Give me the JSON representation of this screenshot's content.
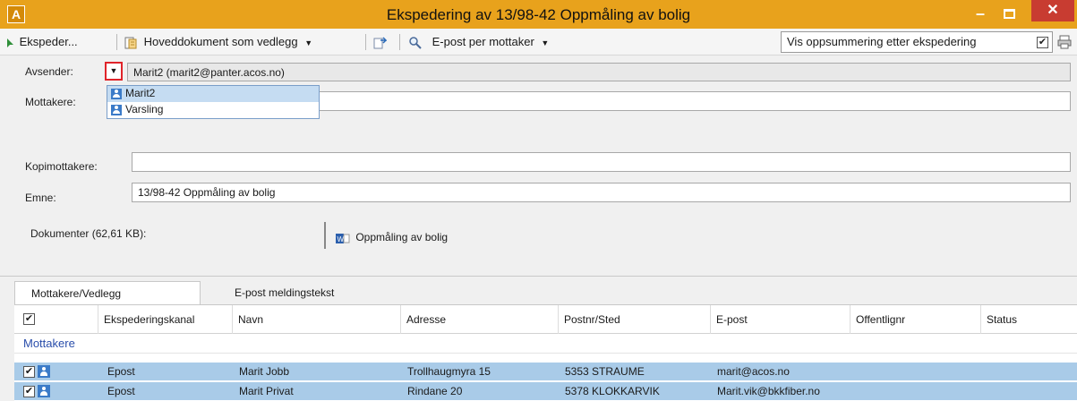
{
  "window": {
    "app_icon_glyph": "A",
    "title": "Ekspedering av 13/98-42 Oppmåling av bolig",
    "minimize_glyph": "–",
    "close_glyph": "✕"
  },
  "toolbar": {
    "ekspeder_label": "Ekspeder...",
    "hoveddokument_label": "Hoveddokument som vedlegg",
    "epost_per_mottaker_label": "E-post per mottaker",
    "vis_oppsummering_label": "Vis oppsummering etter ekspedering",
    "vis_oppsummering_checked": true,
    "icons": [
      "send-icon",
      "document-attach-icon",
      "forward-icon",
      "search-icon",
      "print-icon"
    ]
  },
  "form": {
    "avsender_label": "Avsender:",
    "avsender_value": "Marit2 (marit2@panter.acos.no)",
    "avsender_options": [
      "Marit2",
      "Varsling"
    ],
    "avsender_selected": "Marit2",
    "mottakere_label": "Mottakere:",
    "mottakere_value": "",
    "kopimottakere_label": "Kopimottakere:",
    "kopimottakere_value": "",
    "emne_label": "Emne:",
    "emne_value": "13/98-42 Oppmåling av bolig",
    "dokumenter_label": "Dokumenter (62,61 KB):",
    "document_name": "Oppmåling av bolig"
  },
  "tabs": [
    {
      "label": "Mottakere/Vedlegg",
      "active": true
    },
    {
      "label": "E-post meldingstekst",
      "active": false
    }
  ],
  "grid": {
    "columns": [
      "Ekspederingskanal",
      "Navn",
      "Adresse",
      "Postnr/Sted",
      "E-post",
      "Offentlignr",
      "Status"
    ],
    "header_checked": true,
    "group_label": "Mottakere",
    "rows": [
      {
        "kanal": "Epost",
        "navn": "Marit Jobb",
        "adresse": "Trollhaugmyra 15",
        "postnr_sted": "5353 STRAUME",
        "epost": "marit@acos.no",
        "offentlignr": "",
        "status": "",
        "checked": true
      },
      {
        "kanal": "Epost",
        "navn": "Marit Privat",
        "adresse": "Rindane 20",
        "postnr_sted": "5378 KLOKKARVIK",
        "epost": "Marit.vik@bkkfiber.no",
        "offentlignr": "",
        "status": "",
        "checked": true
      }
    ]
  },
  "colors": {
    "titlebar": "#e8a21c",
    "close_button": "#c83c31",
    "selected_row": "#a9cbe8",
    "group_text": "#2a4eab",
    "dropdown_highlight": "#e0242a"
  }
}
